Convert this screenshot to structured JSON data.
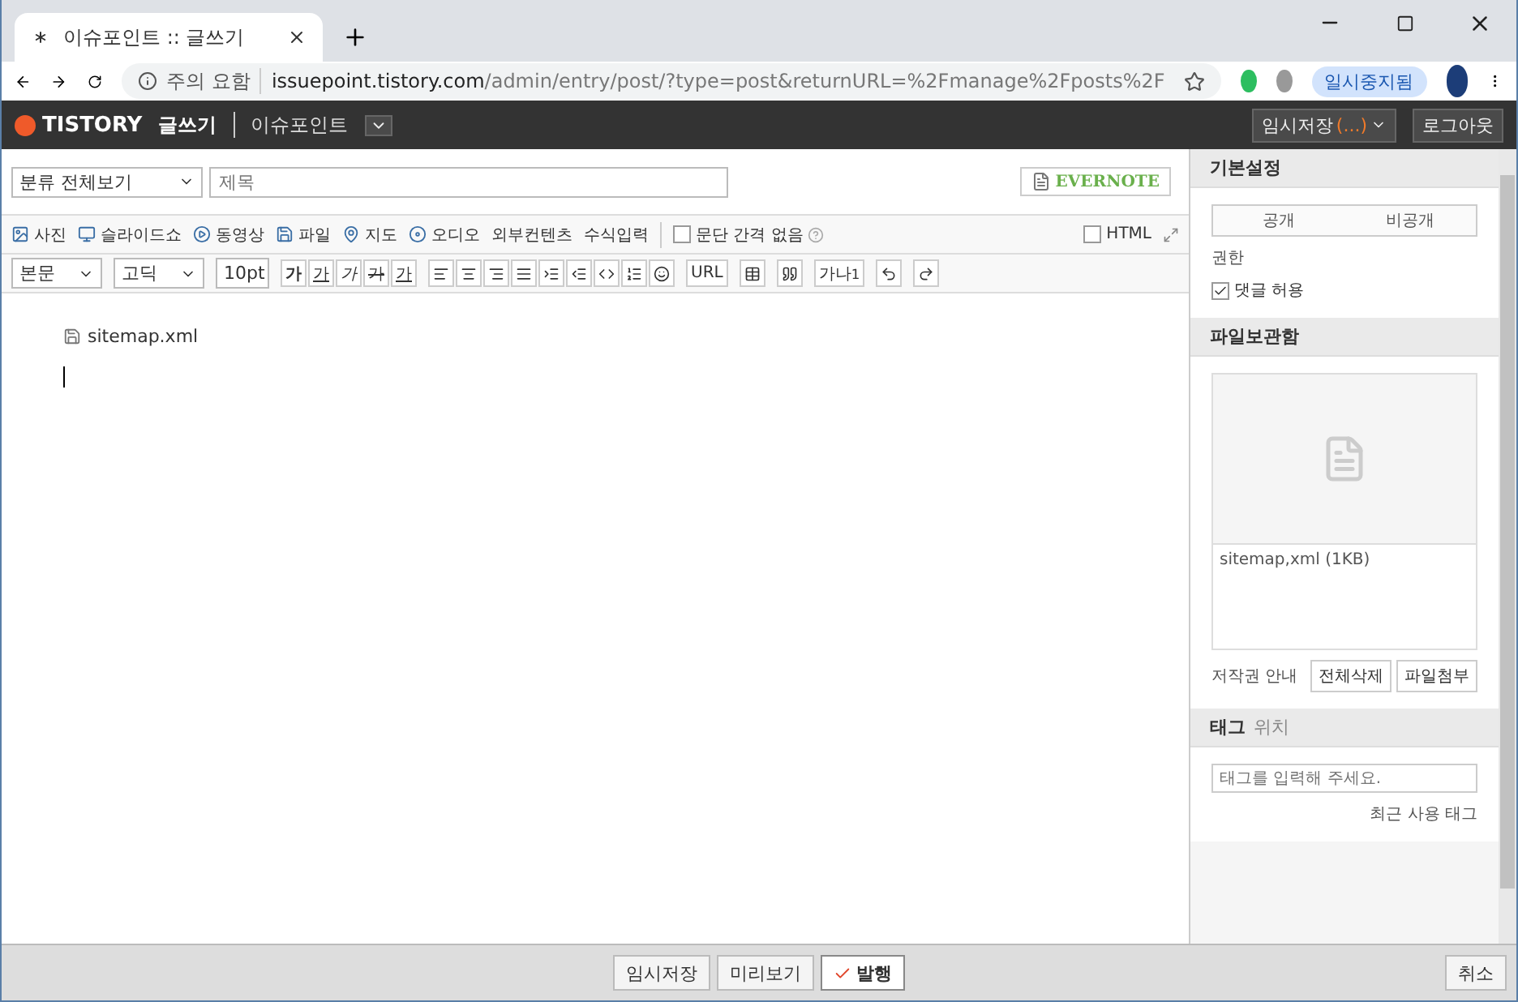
{
  "browser": {
    "tab_title": "이슈포인트 :: 글쓰기",
    "security": "주의 요함",
    "url_host": "issuepoint.tistory.com",
    "url_path": "/admin/entry/post/?type=post&returnURL=%2Fmanage%2Fposts%2F",
    "paused_badge": "일시중지됨"
  },
  "header": {
    "logo": "TISTORY",
    "page": "글쓰기",
    "blog": "이슈포인트",
    "draft_button": "임시저장",
    "draft_count": "(...)",
    "logout": "로그아웃"
  },
  "editor": {
    "category": "분류 전체보기",
    "title_placeholder": "제목",
    "evernote": "EVERNOTE",
    "insert_tools": [
      {
        "label": "사진",
        "kind": "image"
      },
      {
        "label": "슬라이드쇼",
        "kind": "slides"
      },
      {
        "label": "동영상",
        "kind": "video"
      },
      {
        "label": "파일",
        "kind": "file"
      },
      {
        "label": "지도",
        "kind": "map"
      },
      {
        "label": "오디오",
        "kind": "audio"
      },
      {
        "label": "외부컨텐츠",
        "kind": "text"
      },
      {
        "label": "수식입력",
        "kind": "text"
      }
    ],
    "no_paragraph_gap": {
      "label": "문단 간격 없음",
      "checked": false
    },
    "html_mode": {
      "label": "HTML",
      "checked": false
    },
    "format_selects": [
      "본문",
      "고딕",
      "10pt"
    ],
    "format_glyphs": [
      {
        "label": "가",
        "kind": "bold"
      },
      {
        "label": "가",
        "kind": "underline"
      },
      {
        "label": "가",
        "kind": "italic"
      },
      {
        "label": "가",
        "kind": "strike"
      },
      {
        "label": "가",
        "kind": "color"
      }
    ],
    "url_button": "URL",
    "ruby_button": "가나",
    "ruby_mark": "1",
    "attachment": "sitemap.xml"
  },
  "sidebar": {
    "basic": {
      "title": "기본설정",
      "visibility": [
        {
          "label": "공개",
          "selected": false
        },
        {
          "label": "비공개",
          "selected": false
        }
      ],
      "permission_label": "권한",
      "allow_comments": {
        "label": "댓글 허용",
        "checked": true
      }
    },
    "files": {
      "title": "파일보관함",
      "items": [
        "sitemap,xml (1KB)"
      ],
      "copyright": "저작권 안내",
      "delete_all": "전체삭제",
      "attach": "파일첨부"
    },
    "tag_tabs": [
      {
        "label": "태그",
        "selected": true
      },
      {
        "label": "위치",
        "selected": false
      }
    ],
    "tag_placeholder": "태그를 입력해 주세요.",
    "recent_tags": "최근 사용 태그"
  },
  "footer": {
    "buttons": [
      {
        "label": "임시저장",
        "kind": "plain"
      },
      {
        "label": "미리보기",
        "kind": "plain"
      },
      {
        "label": "발행",
        "kind": "primary"
      }
    ],
    "cancel": "취소"
  }
}
